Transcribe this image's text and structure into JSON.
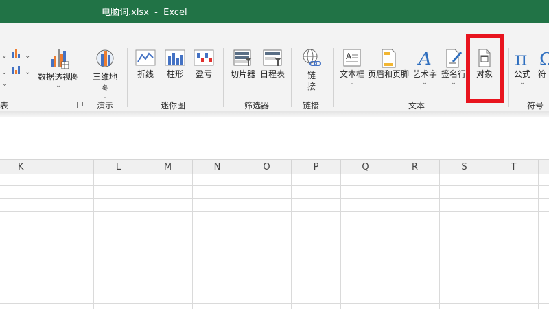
{
  "window": {
    "title": "电脑词.xlsx  -  Excel"
  },
  "colors": {
    "titlebar": "#217346",
    "highlight": "#e8141e"
  },
  "ribbon": {
    "partial_left": {
      "label": "数据透视图",
      "group": "表"
    },
    "demo": {
      "button": "三维地图",
      "button_line1": "三维地",
      "button_line2": "图",
      "group": "演示"
    },
    "sparklines": {
      "buttons": [
        "折线",
        "柱形",
        "盈亏"
      ],
      "group": "迷你图"
    },
    "filters": {
      "buttons": [
        "切片器",
        "日程表"
      ],
      "group": "筛选器"
    },
    "links": {
      "button_line1": "链",
      "button_line2": "接",
      "group": "链接"
    },
    "text": {
      "buttons": [
        "文本框",
        "页眉和页脚",
        "艺术字",
        "签名行",
        "对象"
      ],
      "group": "文本"
    },
    "symbols": {
      "buttons": [
        "公式",
        "符"
      ],
      "group": "符号"
    }
  },
  "sheet": {
    "columns": [
      "K",
      "L",
      "M",
      "N",
      "O",
      "P",
      "Q",
      "R",
      "S",
      "T"
    ]
  }
}
